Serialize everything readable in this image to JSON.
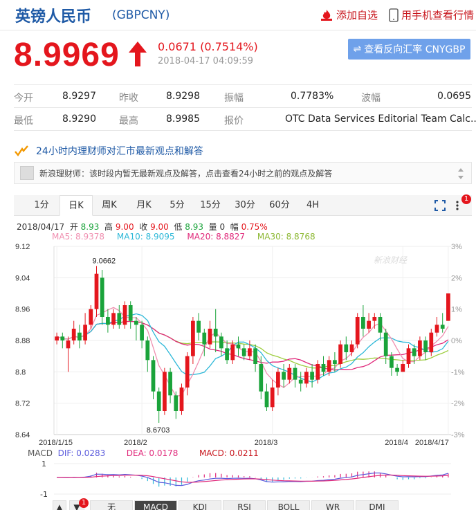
{
  "header": {
    "name": "英镑人民币",
    "code": "(GBPCNY)",
    "add_watchlist": "添加自选",
    "mobile": "用手机查看行情"
  },
  "quote": {
    "price": "8.9969",
    "change": "0.0671 (0.7514%)",
    "time": "2018-04-17 04:09:59",
    "reverse_button": "查看反向汇率 CNYGBP"
  },
  "stats": [
    [
      {
        "l": "今开",
        "v": "8.9297"
      },
      {
        "l": "昨收",
        "v": "8.9298"
      },
      {
        "l": "振幅",
        "v": "0.7783%"
      },
      {
        "l": "波幅",
        "v": "0.0695"
      }
    ],
    [
      {
        "l": "最低",
        "v": "8.9290"
      },
      {
        "l": "最高",
        "v": "8.9985"
      },
      {
        "l": "报价",
        "v": "OTC Data Services Editorial Team Calc..."
      }
    ]
  ],
  "advice": {
    "title": "24小时内理财师对汇市最新观点和解答",
    "message": "新浪理财师：该时段内暂无最新观点及解答，点击查看24小时之前的观点及解答"
  },
  "tabs": [
    "1分",
    "日K",
    "周K",
    "月K",
    "5分",
    "15分",
    "30分",
    "60分",
    "4H"
  ],
  "active_tab": "日K",
  "badge": "1",
  "ohlc": {
    "date": "2018/04/17",
    "open_label": "开",
    "open": "8.93",
    "high_label": "高",
    "high": "9.00",
    "close_label": "收",
    "close": "9.00",
    "low_label": "低",
    "low": "8.93",
    "vol_label": "量",
    "vol": "0",
    "amp_label": "幅",
    "amp": "0.75%"
  },
  "ma": {
    "ma5": "MA5: 8.9378",
    "ma10": "MA10: 8.9095",
    "ma20": "MA20: 8.8827",
    "ma30": "MA30: 8.8768"
  },
  "colors": {
    "up": "#e4161d",
    "down": "#1aa33a",
    "ma5": "#f08fb0",
    "ma10": "#2db8d8",
    "ma20": "#e0287a",
    "ma30": "#9ccd3c"
  },
  "chart_data": {
    "type": "candlestick",
    "y_ticks": [
      "9.12",
      "9.04",
      "8.96",
      "8.88",
      "8.8",
      "8.72",
      "8.64"
    ],
    "ylim": [
      8.64,
      9.12
    ],
    "pct_ticks": [
      "3%",
      "2%",
      "1%",
      "0%",
      "-1%",
      "-2%",
      "-3%"
    ],
    "x_labels": [
      "2018/1/15",
      "2018/2",
      "2018/3",
      "2018/4",
      "2018/4/17"
    ],
    "x_label_index": [
      0,
      15,
      38,
      61,
      69
    ],
    "high_label": "9.0662",
    "low_label": "8.6703",
    "watermark": "新浪财经",
    "candles": [
      [
        8.88,
        8.89,
        8.87,
        8.9
      ],
      [
        8.89,
        8.88,
        8.86,
        8.9
      ],
      [
        8.86,
        8.88,
        8.8,
        8.89
      ],
      [
        8.88,
        8.91,
        8.87,
        8.93
      ],
      [
        8.9,
        8.88,
        8.86,
        8.92
      ],
      [
        8.88,
        8.92,
        8.87,
        8.95
      ],
      [
        8.92,
        8.96,
        8.91,
        8.97
      ],
      [
        8.96,
        9.05,
        8.94,
        9.07
      ],
      [
        9.04,
        8.94,
        8.92,
        9.06
      ],
      [
        8.94,
        8.92,
        8.9,
        8.96
      ],
      [
        8.92,
        8.95,
        8.91,
        8.96
      ],
      [
        8.95,
        8.92,
        8.91,
        8.97
      ],
      [
        8.92,
        8.97,
        8.91,
        8.98
      ],
      [
        8.97,
        8.93,
        8.91,
        8.98
      ],
      [
        8.93,
        8.92,
        8.88,
        8.94
      ],
      [
        8.92,
        8.88,
        8.86,
        8.93
      ],
      [
        8.88,
        8.83,
        8.8,
        8.89
      ],
      [
        8.83,
        8.75,
        8.73,
        8.84
      ],
      [
        8.75,
        8.7,
        8.67,
        8.76
      ],
      [
        8.7,
        8.8,
        8.69,
        8.81
      ],
      [
        8.8,
        8.74,
        8.72,
        8.81
      ],
      [
        8.74,
        8.7,
        8.68,
        8.75
      ],
      [
        8.7,
        8.76,
        8.69,
        8.77
      ],
      [
        8.76,
        8.84,
        8.74,
        8.85
      ],
      [
        8.84,
        8.93,
        8.82,
        8.94
      ],
      [
        8.93,
        8.9,
        8.88,
        8.95
      ],
      [
        8.9,
        8.87,
        8.84,
        8.91
      ],
      [
        8.87,
        8.91,
        8.86,
        8.93
      ],
      [
        8.91,
        8.89,
        8.85,
        8.96
      ],
      [
        8.89,
        8.86,
        8.84,
        8.9
      ],
      [
        8.86,
        8.83,
        8.82,
        8.88
      ],
      [
        8.83,
        8.87,
        8.82,
        8.88
      ],
      [
        8.87,
        8.86,
        8.84,
        8.89
      ],
      [
        8.86,
        8.84,
        8.83,
        8.87
      ],
      [
        8.84,
        8.86,
        8.83,
        8.88
      ],
      [
        8.86,
        8.82,
        8.8,
        8.87
      ],
      [
        8.82,
        8.75,
        8.73,
        8.84
      ],
      [
        8.75,
        8.71,
        8.7,
        8.77
      ],
      [
        8.71,
        8.76,
        8.7,
        8.78
      ],
      [
        8.76,
        8.8,
        8.74,
        8.81
      ],
      [
        8.8,
        8.78,
        8.76,
        8.82
      ],
      [
        8.78,
        8.81,
        8.77,
        8.82
      ],
      [
        8.81,
        8.78,
        8.76,
        8.82
      ],
      [
        8.78,
        8.77,
        8.75,
        8.8
      ],
      [
        8.77,
        8.8,
        8.76,
        8.81
      ],
      [
        8.8,
        8.78,
        8.76,
        8.82
      ],
      [
        8.78,
        8.82,
        8.77,
        8.83
      ],
      [
        8.82,
        8.8,
        8.79,
        8.84
      ],
      [
        8.8,
        8.83,
        8.79,
        8.84
      ],
      [
        8.83,
        8.82,
        8.8,
        8.85
      ],
      [
        8.82,
        8.87,
        8.81,
        8.88
      ],
      [
        8.87,
        8.85,
        8.83,
        8.89
      ],
      [
        8.85,
        8.87,
        8.84,
        8.88
      ],
      [
        8.87,
        8.94,
        8.86,
        8.95
      ],
      [
        8.94,
        8.91,
        8.89,
        8.97
      ],
      [
        8.91,
        8.93,
        8.9,
        8.95
      ],
      [
        8.93,
        8.94,
        8.91,
        8.95
      ],
      [
        8.94,
        8.9,
        8.88,
        8.95
      ],
      [
        8.9,
        8.84,
        8.82,
        8.91
      ],
      [
        8.84,
        8.81,
        8.79,
        8.85
      ],
      [
        8.81,
        8.8,
        8.79,
        8.82
      ],
      [
        8.8,
        8.82,
        8.8,
        8.83
      ],
      [
        8.82,
        8.86,
        8.81,
        8.87
      ],
      [
        8.86,
        8.84,
        8.82,
        8.87
      ],
      [
        8.84,
        8.88,
        8.83,
        8.89
      ],
      [
        8.88,
        8.85,
        8.83,
        8.89
      ],
      [
        8.85,
        8.9,
        8.84,
        8.91
      ],
      [
        8.9,
        8.92,
        8.89,
        8.94
      ],
      [
        8.92,
        8.91,
        8.9,
        8.95
      ],
      [
        8.93,
        9.0,
        8.93,
        9.0
      ]
    ]
  },
  "macd": {
    "label": "MACD",
    "dif": "DIF: 0.0283",
    "dea": "DEA: 0.0178",
    "macd": "MACD: 0.0211",
    "ticks": [
      "1",
      "-1"
    ]
  },
  "bottom_tabs": [
    "无",
    "MACD",
    "KDJ",
    "RSI",
    "BOLL",
    "WR",
    "DMI"
  ],
  "bottom_active": "MACD",
  "bottom_badge": "1"
}
